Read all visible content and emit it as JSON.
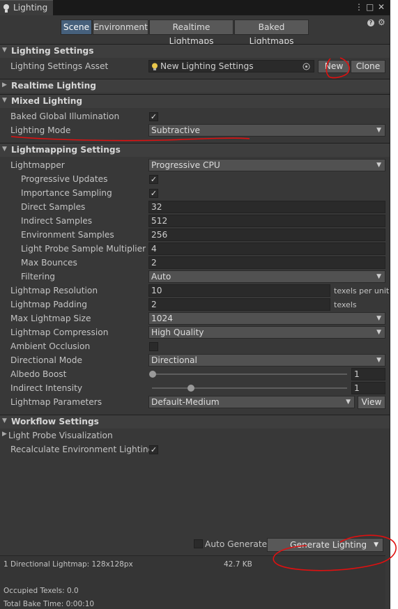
{
  "window": {
    "tab_title": "Lighting",
    "menu_glyph": "⋮",
    "maximize_glyph": "□",
    "close_glyph": "✕"
  },
  "toolbar": {
    "tabs": [
      "Scene",
      "Environment",
      "Realtime Lightmaps",
      "Baked Lightmaps"
    ],
    "active_tab": "Scene",
    "help_glyph": "?",
    "settings_glyph": "⚙"
  },
  "lighting_settings": {
    "header": "Lighting Settings",
    "asset_label": "Lighting Settings Asset",
    "asset_value": "New Lighting Settings",
    "new_button": "New",
    "clone_button": "Clone"
  },
  "realtime_lighting": {
    "header": "Realtime Lighting"
  },
  "mixed_lighting": {
    "header": "Mixed Lighting",
    "baked_gi_label": "Baked Global Illumination",
    "baked_gi_checked": true,
    "lighting_mode_label": "Lighting Mode",
    "lighting_mode_value": "Subtractive"
  },
  "lightmapping": {
    "header": "Lightmapping Settings",
    "lightmapper_label": "Lightmapper",
    "lightmapper_value": "Progressive CPU",
    "progressive_updates_label": "Progressive Updates",
    "progressive_updates_checked": true,
    "importance_sampling_label": "Importance Sampling",
    "importance_sampling_checked": true,
    "direct_samples_label": "Direct Samples",
    "direct_samples_value": "32",
    "indirect_samples_label": "Indirect Samples",
    "indirect_samples_value": "512",
    "environment_samples_label": "Environment Samples",
    "environment_samples_value": "256",
    "probe_multiplier_label": "Light Probe Sample Multiplier",
    "probe_multiplier_value": "4",
    "max_bounces_label": "Max Bounces",
    "max_bounces_value": "2",
    "filtering_label": "Filtering",
    "filtering_value": "Auto",
    "resolution_label": "Lightmap Resolution",
    "resolution_value": "10",
    "resolution_unit": "texels per unit",
    "padding_label": "Lightmap Padding",
    "padding_value": "2",
    "padding_unit": "texels",
    "max_size_label": "Max Lightmap Size",
    "max_size_value": "1024",
    "compression_label": "Lightmap Compression",
    "compression_value": "High Quality",
    "ambient_occlusion_label": "Ambient Occlusion",
    "ambient_occlusion_checked": false,
    "directional_mode_label": "Directional Mode",
    "directional_mode_value": "Directional",
    "albedo_boost_label": "Albedo Boost",
    "albedo_boost_value": "1",
    "albedo_boost_fraction": 0.0,
    "indirect_intensity_label": "Indirect Intensity",
    "indirect_intensity_value": "1",
    "indirect_intensity_fraction": 0.2,
    "parameters_label": "Lightmap Parameters",
    "parameters_value": "Default-Medium",
    "view_button": "View"
  },
  "workflow": {
    "header": "Workflow Settings",
    "probe_vis_label": "Light Probe Visualization",
    "recalc_env_label": "Recalculate Environment Lighting",
    "recalc_env_checked": true
  },
  "generate": {
    "auto_generate_label": "Auto Generate",
    "auto_generate_checked": false,
    "generate_button": "Generate Lighting"
  },
  "stats": {
    "lightmap_summary": "1 Directional Lightmap: 128x128px",
    "lightmap_size": "42.7 KB",
    "occupied_texels": "Occupied Texels: 0.0",
    "bake_time": "Total Bake Time: 0:00:10"
  },
  "colors": {
    "annotation": "#e01010",
    "active_tab": "#46607c",
    "background": "#383838"
  }
}
